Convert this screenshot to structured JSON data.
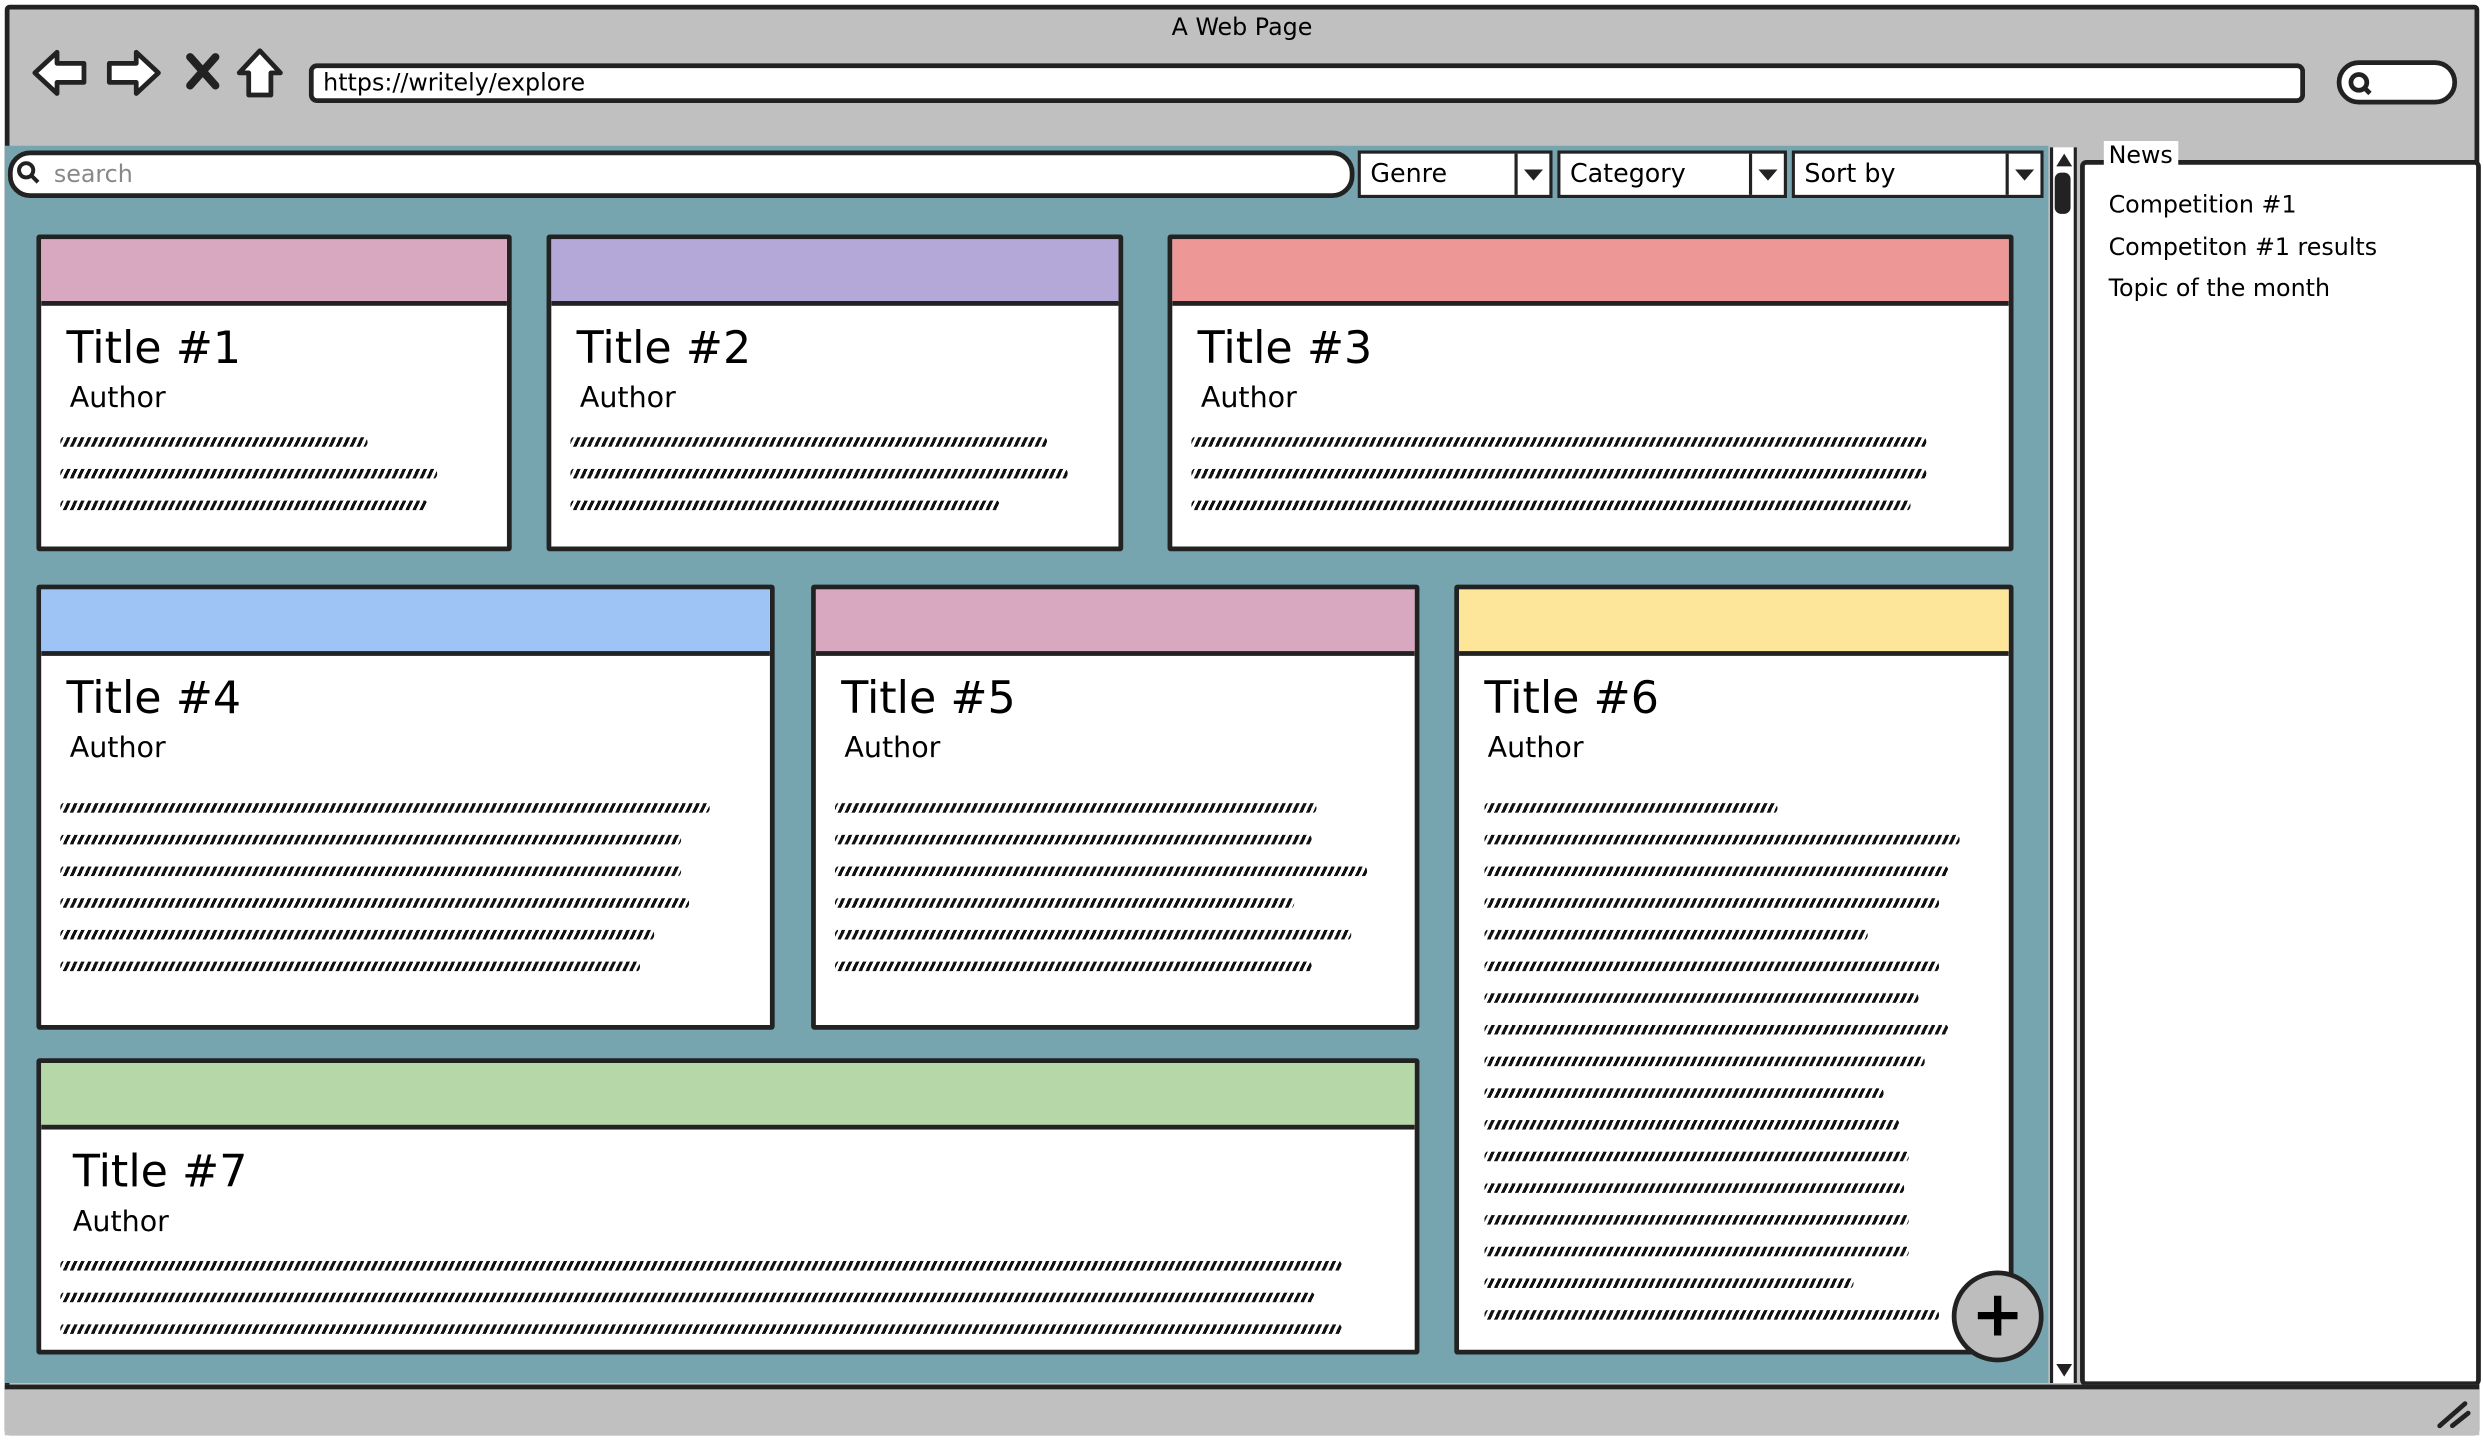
{
  "window": {
    "title": "A Web Page"
  },
  "browser": {
    "url": "https://writely/explore"
  },
  "toolbar": {
    "search_placeholder": "search",
    "filters": [
      "Genre",
      "Category",
      "Sort by"
    ]
  },
  "cards": [
    {
      "title": "Title #1",
      "author": "Author",
      "color": "#d8a8c0"
    },
    {
      "title": "Title #2",
      "author": "Author",
      "color": "#b3a8d8"
    },
    {
      "title": "Title #3",
      "author": "Author",
      "color": "#ed9797"
    },
    {
      "title": "Title #4",
      "author": "Author",
      "color": "#9ec4f6"
    },
    {
      "title": "Title #5",
      "author": "Author",
      "color": "#d8a8c0"
    },
    {
      "title": "Title #6",
      "author": "Author",
      "color": "#fde69a"
    },
    {
      "title": "Title #7",
      "author": "Author",
      "color": "#b6d8a8"
    }
  ],
  "news": {
    "title": "News",
    "items": [
      "Competition #1",
      "Competiton #1 results",
      "Topic of the month"
    ]
  },
  "colors": {
    "content_bg": "#76a5b0",
    "chrome": "#c0c0c0"
  }
}
